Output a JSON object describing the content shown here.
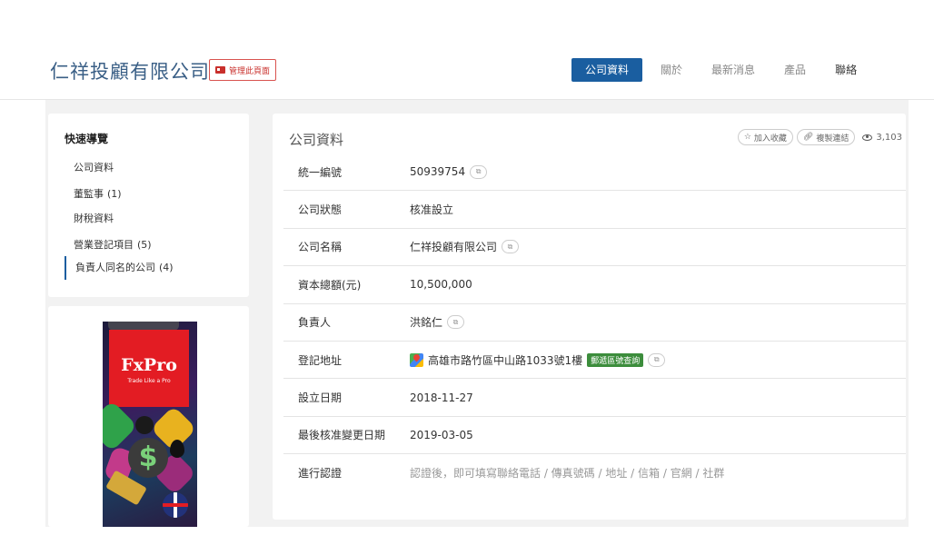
{
  "header": {
    "company_name": "仁祥投顧有限公司",
    "manage_label": "管理此頁面",
    "nav": [
      {
        "label": "公司資料",
        "active": true
      },
      {
        "label": "關於"
      },
      {
        "label": "最新消息"
      },
      {
        "label": "產品"
      },
      {
        "label": "聯絡"
      }
    ]
  },
  "quick_nav": {
    "title": "快速導覽",
    "items": [
      {
        "label": "公司資料",
        "count": ""
      },
      {
        "label": "董監事",
        "count": "(1)"
      },
      {
        "label": "財稅資料",
        "count": ""
      },
      {
        "label": "營業登記項目",
        "count": "(5)"
      },
      {
        "label": "負責人同名的公司",
        "count": "(4)"
      }
    ]
  },
  "ad": {
    "brand": "FxPro",
    "slogan": "Trade Like a Pro"
  },
  "info": {
    "title": "公司資料",
    "add_favorite": "加入收藏",
    "copy_link": "複製連結",
    "views": "3,103",
    "rows": [
      {
        "label": "統一編號",
        "value": "50939754"
      },
      {
        "label": "公司狀態",
        "value": "核准設立"
      },
      {
        "label": "公司名稱",
        "value": "仁祥投顧有限公司"
      },
      {
        "label": "資本總額(元)",
        "value": "10,500,000"
      },
      {
        "label": "負責人",
        "value": "洪銘仁"
      },
      {
        "label": "登記地址",
        "value": "高雄市路竹區中山路1033號1樓",
        "badge": "郵遞區號查詢"
      },
      {
        "label": "設立日期",
        "value": "2018-11-27"
      },
      {
        "label": "最後核准變更日期",
        "value": "2019-03-05"
      },
      {
        "label": "進行認證",
        "value": "認證後，即可填寫聯絡電話 / 傳真號碼 / 地址 / 信箱 / 官網 / 社群"
      }
    ]
  },
  "colors": {
    "primary": "#1a5ea0",
    "title": "#3a5f86",
    "manage": "#c9302c",
    "badge": "#3c8d3c"
  }
}
